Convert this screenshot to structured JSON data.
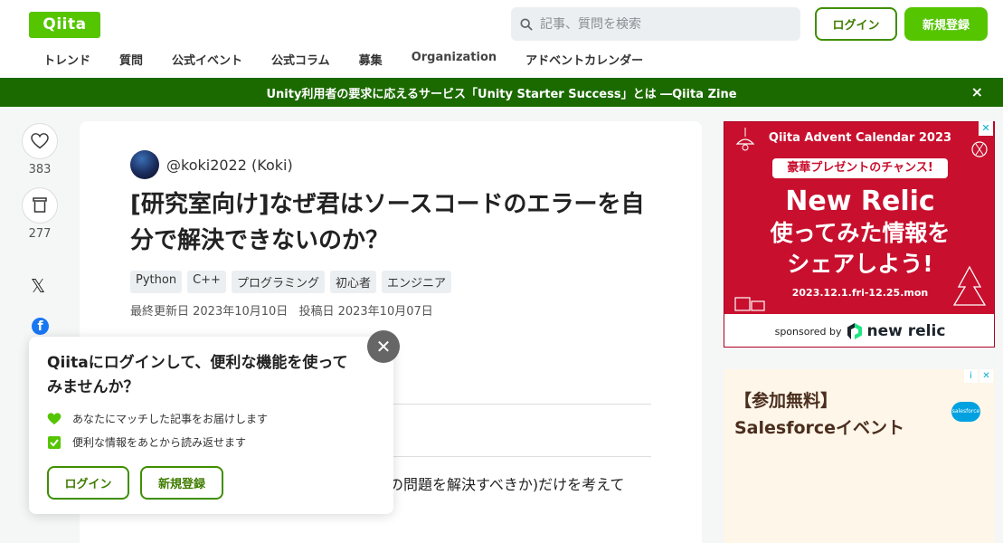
{
  "header": {
    "logo": "Qiita",
    "search_placeholder": "記事、質問を検索",
    "login_label": "ログイン",
    "signup_label": "新規登録"
  },
  "nav": {
    "items": [
      "トレンド",
      "質問",
      "公式イベント",
      "公式コラム",
      "募集",
      "Organization",
      "アドベントカレンダー"
    ]
  },
  "banner": {
    "text": "Unity利用者の要求に応えるサービス「Unity Starter Success」とは ―Qiita Zine",
    "close": "×"
  },
  "side": {
    "like_count": "383",
    "stock_count": "277"
  },
  "article": {
    "author": "@koki2022 (Koki)",
    "title": "[研究室向け]なぜ君はソースコードのエラーを自分で解決できないのか？",
    "tags": [
      "Python",
      "C++",
      "プログラミング",
      "初心者",
      "エンジニア"
    ],
    "updated": "最終更新日 2023年10月10日",
    "posted": "投稿日 2023年10月07日",
    "body_line1": "の問題を解決すべきか)だけを考えて",
    "body_line2": "   "
  },
  "popup": {
    "title": "Qiitaにログインして、便利な機能を使ってみませんか？",
    "item1": "あなたにマッチした記事をお届けします",
    "item2": "便利な情報をあとから読み返せます",
    "login_label": "ログイン",
    "signup_label": "新規登録",
    "close": "✕"
  },
  "ad1": {
    "title": "Qiita Advent Calendar 2023",
    "pill": "豪華プレゼントのチャンス!",
    "big1": "New Relic",
    "big2_line1": "使ってみた情報を",
    "big2_line2": "シェアしよう!",
    "dates": "2023.12.1.fri-12.25.mon",
    "sponsored": "sponsored by",
    "brand": "new relic"
  },
  "ad2": {
    "line1": "【参加無料】",
    "line2": "Salesforceイベント",
    "logo": "salesforce"
  },
  "colors": {
    "brand_green": "#55c500",
    "banner_green": "#1b6a00",
    "ad_red": "#c8102e"
  }
}
